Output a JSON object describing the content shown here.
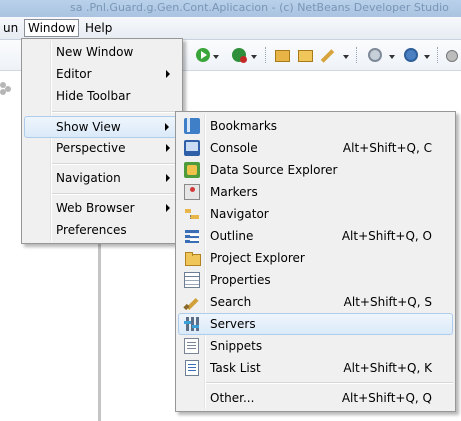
{
  "window": {
    "title_fragment": "sa .Pnl.Guard.g.Gen.Cont.Aplicacion - (c) NetBeans Developer Studio"
  },
  "menubar": {
    "items": [
      {
        "label": "un"
      },
      {
        "label": "Window"
      },
      {
        "label": "Help"
      }
    ]
  },
  "toolbar": {
    "icons": [
      "run-icon",
      "debug-icon",
      "open-folder-icon",
      "folder-icon",
      "edit-icon",
      "gear-icon",
      "web-service-icon",
      "stop-icon"
    ]
  },
  "window_menu": {
    "items": [
      {
        "label": "New Window"
      },
      {
        "label": "Editor"
      },
      {
        "label": "Hide Toolbar"
      },
      {
        "label": "Show View"
      },
      {
        "label": "Perspective"
      },
      {
        "label": "Navigation"
      },
      {
        "label": "Web Browser"
      },
      {
        "label": "Preferences"
      }
    ]
  },
  "show_view_menu": {
    "items": [
      {
        "label": "Bookmarks",
        "shortcut": "",
        "icon": "bookmarks-icon"
      },
      {
        "label": "Console",
        "shortcut": "Alt+Shift+Q, C",
        "icon": "console-icon"
      },
      {
        "label": "Data Source Explorer",
        "shortcut": "",
        "icon": "data-source-explorer-icon"
      },
      {
        "label": "Markers",
        "shortcut": "",
        "icon": "markers-icon"
      },
      {
        "label": "Navigator",
        "shortcut": "",
        "icon": "navigator-icon"
      },
      {
        "label": "Outline",
        "shortcut": "Alt+Shift+Q, O",
        "icon": "outline-icon"
      },
      {
        "label": "Project Explorer",
        "shortcut": "",
        "icon": "project-explorer-icon"
      },
      {
        "label": "Properties",
        "shortcut": "",
        "icon": "properties-icon"
      },
      {
        "label": "Search",
        "shortcut": "Alt+Shift+Q, S",
        "icon": "search-icon"
      },
      {
        "label": "Servers",
        "shortcut": "",
        "icon": "servers-icon"
      },
      {
        "label": "Snippets",
        "shortcut": "",
        "icon": "snippets-icon"
      },
      {
        "label": "Task List",
        "shortcut": "Alt+Shift+Q, K",
        "icon": "task-list-icon"
      },
      {
        "label": "Other...",
        "shortcut": "Alt+Shift+Q, Q",
        "icon": ""
      }
    ],
    "highlighted": "Servers"
  }
}
